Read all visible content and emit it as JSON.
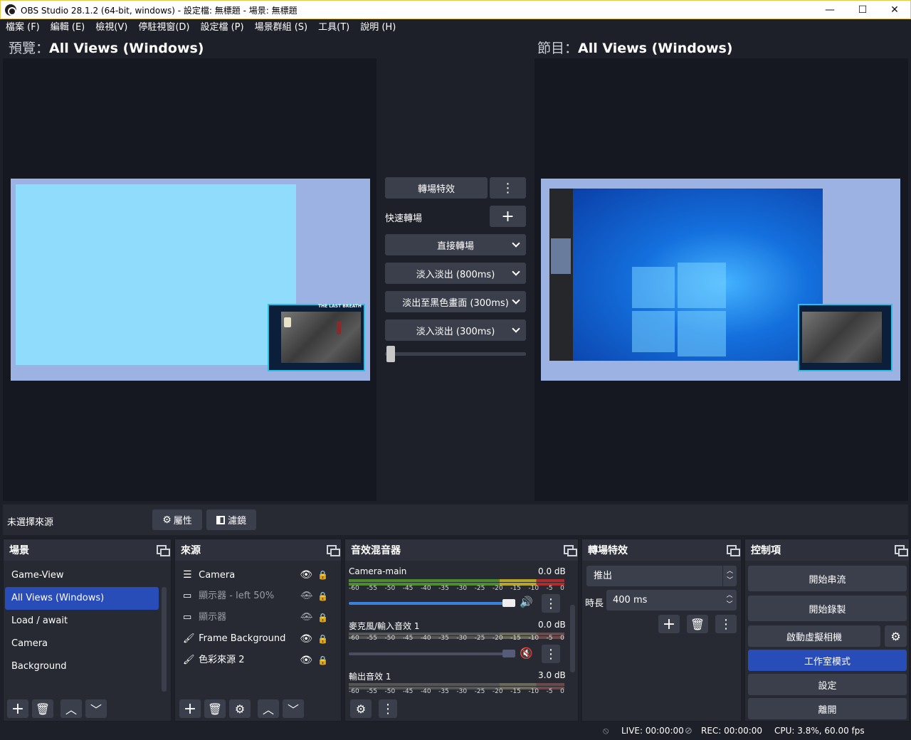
{
  "window": {
    "title": "OBS Studio 28.1.2 (64-bit, windows) - 設定檔: 無標題 - 場景: 無標題",
    "minimize": "—",
    "maximize": "☐",
    "close": "✕"
  },
  "menu": [
    "檔案 (F)",
    "編輯 (E)",
    "檢視(V)",
    "停駐視窗(D)",
    "設定檔 (P)",
    "場景群組 (S)",
    "工具(T)",
    "說明 (H)"
  ],
  "preview": {
    "prefix": "預覽：",
    "name": "All Views (Windows)"
  },
  "program": {
    "prefix": "節目：",
    "name": "All Views (Windows)"
  },
  "transitions_center": {
    "effect_button": "轉場特效",
    "quick_label": "快速轉場",
    "items": [
      "直接轉場",
      "淡入淡出 (800ms)",
      "淡出至黑色畫面 (300ms)",
      "淡入淡出 (300ms)"
    ],
    "tbar_value": 0.0
  },
  "overlay_text": "THE LAST BREATH",
  "source_bar": {
    "label": "未選擇來源",
    "properties": "屬性",
    "filters": "濾鏡"
  },
  "scenes": {
    "title": "場景",
    "items": [
      "Game-View",
      "All Views (Windows)",
      "Load / await",
      "Camera",
      "Background"
    ],
    "selected": "All Views (Windows)"
  },
  "sources": {
    "title": "來源",
    "items": [
      {
        "name": "Camera",
        "icon": "list-icon",
        "visible": true
      },
      {
        "name": "顯示器 - left 50%",
        "icon": "monitor-icon",
        "visible": false
      },
      {
        "name": "顯示器",
        "icon": "monitor-icon",
        "visible": false
      },
      {
        "name": "Frame Background",
        "icon": "brush-icon",
        "visible": true
      },
      {
        "name": "色彩來源 2",
        "icon": "brush-icon",
        "visible": true
      }
    ]
  },
  "mixer": {
    "title": "音效混音器",
    "ticks": [
      "-60",
      "-55",
      "-50",
      "-45",
      "-40",
      "-35",
      "-30",
      "-25",
      "-20",
      "-15",
      "-10",
      "-5",
      "0"
    ],
    "channels": [
      {
        "name": "Camera-main",
        "db": "0.0 dB",
        "volume": 1.0,
        "muted": false,
        "level": 1.0
      },
      {
        "name": "麥克風/輸入音效 1",
        "db": "0.0 dB",
        "volume": 1.0,
        "muted": true,
        "level": 1.0
      },
      {
        "name": "輸出音效 1",
        "db": "3.0 dB",
        "volume": 1.0,
        "muted": false,
        "level": 1.0
      }
    ]
  },
  "transitions_dock": {
    "title": "轉場特效",
    "selected": "推出",
    "duration_label": "時長",
    "duration_value": "400 ms"
  },
  "controls": {
    "title": "控制項",
    "start_stream": "開始串流",
    "start_record": "開始錄製",
    "virtual_cam": "啟動虛擬相機",
    "studio_mode": "工作室模式",
    "settings": "設定",
    "exit": "離開"
  },
  "status": {
    "live": "LIVE: 00:00:00",
    "rec": "REC: 00:00:00",
    "cpu": "CPU: 3.8%, 60.00 fps"
  },
  "colors": {
    "accent": "#284cb8",
    "background": "#1e2029",
    "dock": "#272a33",
    "button": "#3b3f4c",
    "muted": "#d12b2b"
  }
}
